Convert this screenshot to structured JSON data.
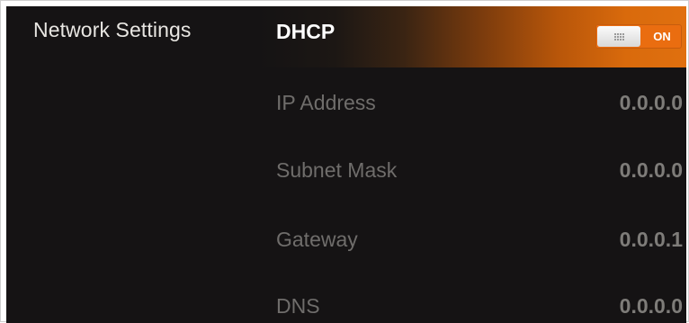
{
  "sidebar": {
    "title": "Network Settings"
  },
  "dhcp": {
    "label": "DHCP",
    "toggle_state": "ON"
  },
  "fields": [
    {
      "label": "IP Address",
      "value": "0.0.0.0"
    },
    {
      "label": "Subnet Mask",
      "value": "0.0.0.0"
    },
    {
      "label": "Gateway",
      "value": "0.0.0.1"
    },
    {
      "label": "DNS",
      "value": "0.0.0.0"
    }
  ],
  "colors": {
    "background": "#151314",
    "accent": "#ea6d10",
    "label": "#6f6d6b",
    "value": "#7e7c79",
    "text_primary": "#ffffff"
  },
  "icons": {
    "toggle_grip": "grip-dots-icon"
  }
}
